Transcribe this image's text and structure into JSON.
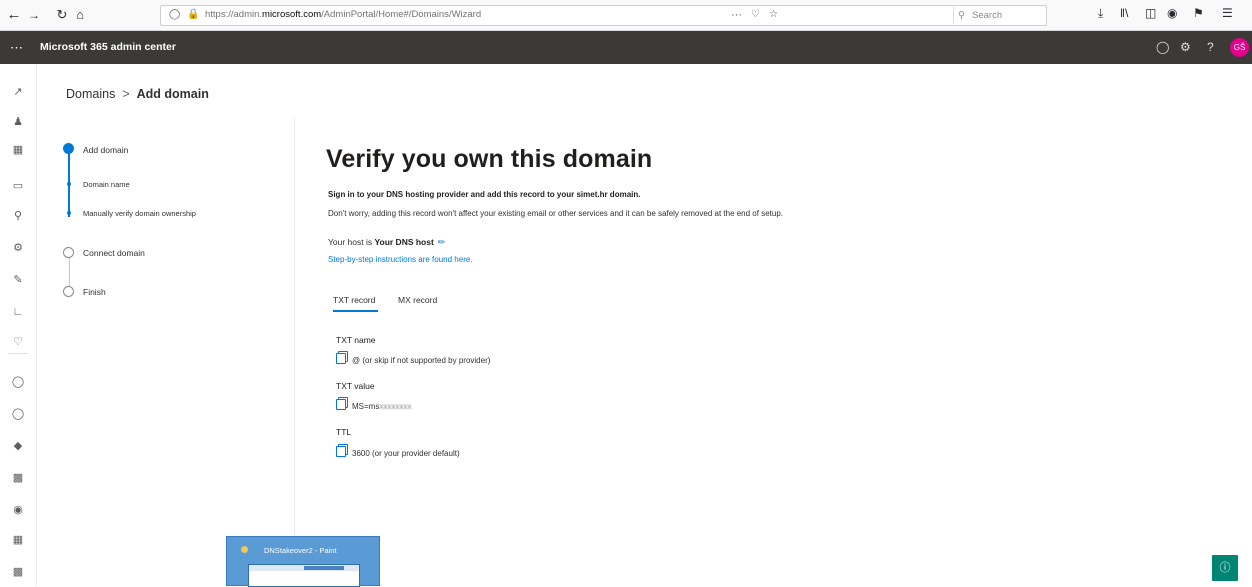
{
  "browser": {
    "url_prefix": "https://admin.",
    "url_domain": "microsoft.com",
    "url_path": "/AdminPortal/Home#/Domains/Wizard",
    "search_placeholder": "Search",
    "page_actions": "···"
  },
  "header": {
    "app_title": "Microsoft 365 admin center",
    "avatar_initials": "GŠ",
    "help": "?"
  },
  "breadcrumb": {
    "parent": "Domains",
    "separator": ">",
    "current": "Add domain"
  },
  "wizard": {
    "steps": [
      {
        "label": "Add domain",
        "state": "current"
      },
      {
        "label": "Domain name",
        "state": "done-sub"
      },
      {
        "label": "Manually verify domain ownership",
        "state": "current-sub"
      },
      {
        "label": "Connect domain",
        "state": "pending"
      },
      {
        "label": "Finish",
        "state": "pending"
      }
    ]
  },
  "main": {
    "title": "Verify you own this domain",
    "instruction_bold": "Sign in to your DNS hosting provider and add this record to your simet.hr domain.",
    "instruction": "Don't worry, adding this record won't affect your existing email or other services and it can be safely removed at the end of setup.",
    "host_prefix": "Your host is ",
    "host_name": "Your DNS host",
    "link": "Step-by-step instructions are found here.",
    "tabs": [
      {
        "label": "TXT record",
        "selected": true
      },
      {
        "label": "MX record",
        "selected": false
      }
    ],
    "fields": [
      {
        "label": "TXT name",
        "value": "@ (or skip if not supported by provider)"
      },
      {
        "label": "TXT value",
        "value_prefix": "MS=ms",
        "value_blurred": "xxxxxxxx"
      },
      {
        "label": "TTL",
        "value": "3600 (or your provider default)"
      }
    ]
  },
  "taskbar_thumb": {
    "title": "DNStakeover2 - Paint"
  },
  "colors": {
    "accent": "#0078d4",
    "suite_header": "#3b3a39",
    "avatar": "#e3008c",
    "help_button": "#008575"
  }
}
